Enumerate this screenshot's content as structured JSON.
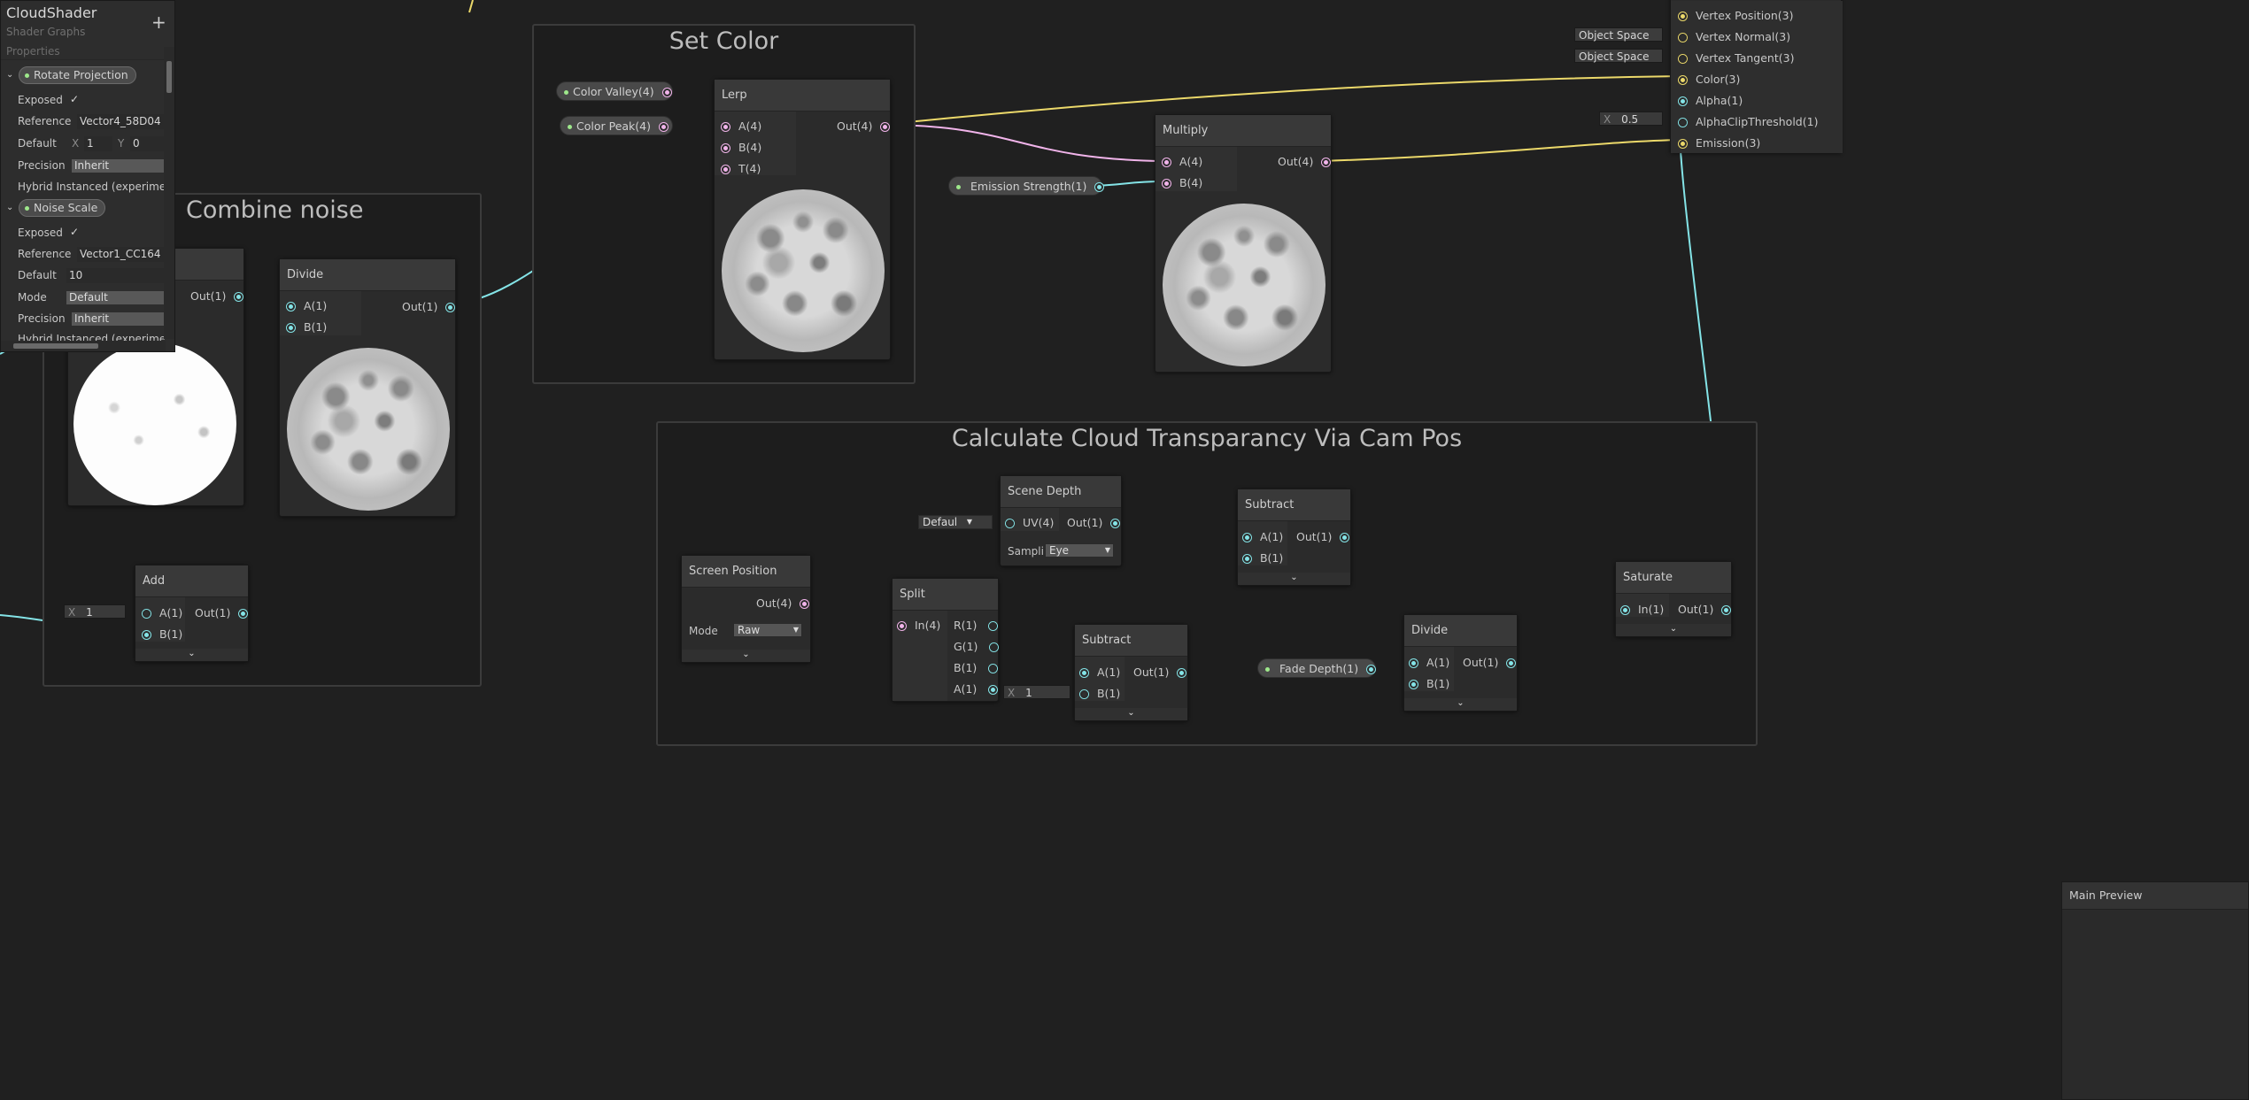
{
  "blackboard": {
    "title": "CloudShader",
    "subtitle": "Shader Graphs",
    "add_label": "+",
    "section_label": "Properties",
    "properties": [
      {
        "name": "Rotate Projection",
        "exposed_label": "Exposed",
        "exposed_check": "✓",
        "reference_label": "Reference",
        "reference_value": "Vector4_58D04",
        "default_label": "Default",
        "default_x_label": "X",
        "default_x": "1",
        "default_y_label": "Y",
        "default_y": "0",
        "precision_label": "Precision",
        "precision_value": "Inherit",
        "hybrid_label": "Hybrid Instanced (experimer"
      },
      {
        "name": "Noise Scale",
        "exposed_label": "Exposed",
        "exposed_check": "✓",
        "reference_label": "Reference",
        "reference_value": "Vector1_CC164",
        "default_label": "Default",
        "default_value": "10",
        "mode_label": "Mode",
        "mode_value": "Default",
        "precision_label": "Precision",
        "precision_value": "Inherit",
        "hybrid_label": "Hybrid Instanced (experimer"
      }
    ]
  },
  "groups": {
    "combine_noise": "Combine noise",
    "set_color": "Set Color",
    "cloud_transparency": "Calculate Cloud Transparancy Via Cam Pos"
  },
  "nodes": {
    "partial_node": {
      "out": "Out(1)"
    },
    "divide_a": {
      "title": "Divide",
      "in_a": "A(1)",
      "in_b": "B(1)",
      "out": "Out(1)"
    },
    "add": {
      "title": "Add",
      "in_a": "A(1)",
      "in_b": "B(1)",
      "out": "Out(1)",
      "x_label": "X",
      "x_value": "1"
    },
    "lerp": {
      "title": "Lerp",
      "in_a": "A(4)",
      "in_b": "B(4)",
      "in_t": "T(4)",
      "out": "Out(4)"
    },
    "multiply": {
      "title": "Multiply",
      "in_a": "A(4)",
      "in_b": "B(4)",
      "out": "Out(4)"
    },
    "screen_position": {
      "title": "Screen Position",
      "out": "Out(4)",
      "mode_label": "Mode",
      "mode_value": "Raw"
    },
    "split": {
      "title": "Split",
      "in": "In(4)",
      "r": "R(1)",
      "g": "G(1)",
      "b": "B(1)",
      "a": "A(1)"
    },
    "scene_depth": {
      "title": "Scene Depth",
      "in_uv": "UV(4)",
      "out": "Out(1)",
      "sampling_label": "Sampli",
      "sampling_value": "Eye",
      "uv_default": "Defaul"
    },
    "subtract_a": {
      "title": "Subtract",
      "in_a": "A(1)",
      "in_b": "B(1)",
      "out": "Out(1)",
      "x_label": "X",
      "x_value": "1"
    },
    "subtract_b": {
      "title": "Subtract",
      "in_a": "A(1)",
      "in_b": "B(1)",
      "out": "Out(1)"
    },
    "divide_b": {
      "title": "Divide",
      "in_a": "A(1)",
      "in_b": "B(1)",
      "out": "Out(1)"
    },
    "saturate": {
      "title": "Saturate",
      "in": "In(1)",
      "out": "Out(1)"
    }
  },
  "property_pills": {
    "color_valley": "Color Valley(4)",
    "color_peak": "Color Peak(4)",
    "emission_strength": "Emission Strength(1)",
    "fade_depth": "Fade Depth(1)"
  },
  "master": {
    "ports": [
      "Vertex Position(3)",
      "Vertex Normal(3)",
      "Vertex Tangent(3)",
      "Color(3)",
      "Alpha(1)",
      "AlphaClipThreshold(1)",
      "Emission(3)"
    ],
    "space_normal": "Object Space",
    "space_tangent": "Object Space",
    "clip_x_label": "X",
    "clip_x_value": "0.5"
  },
  "main_preview": {
    "title": "Main Preview"
  },
  "colors": {
    "background": "#202020",
    "wire_float": "#84e4e7",
    "wire_vector4": "#f1b4ea",
    "wire_vector3": "#ecd96a",
    "node_body": "#2b2b2b",
    "node_header": "#393939"
  }
}
